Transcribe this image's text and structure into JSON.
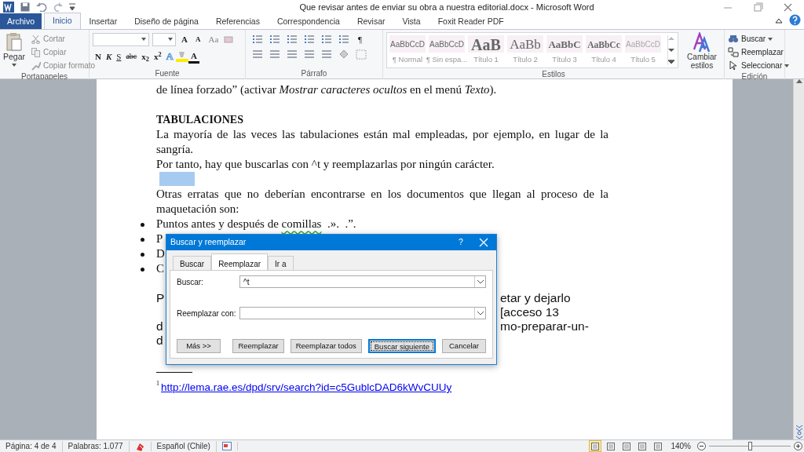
{
  "window": {
    "title": "Que revisar antes de enviar su obra a nuestra editorial.docx  -  Microsoft Word"
  },
  "ribbon_tabs": [
    {
      "label": "Archivo",
      "kind": "file",
      "selected": false
    },
    {
      "label": "Inicio",
      "kind": "tab",
      "selected": true
    },
    {
      "label": "Insertar",
      "kind": "tab",
      "selected": false
    },
    {
      "label": "Diseño de página",
      "kind": "tab",
      "selected": false
    },
    {
      "label": "Referencias",
      "kind": "tab",
      "selected": false
    },
    {
      "label": "Correspondencia",
      "kind": "tab",
      "selected": false
    },
    {
      "label": "Revisar",
      "kind": "tab",
      "selected": false
    },
    {
      "label": "Vista",
      "kind": "tab",
      "selected": false
    },
    {
      "label": "Foxit Reader PDF",
      "kind": "tab",
      "selected": false
    }
  ],
  "clipboard": {
    "paste": "Pegar",
    "commands": [
      "Cortar",
      "Copiar",
      "Copiar formato"
    ],
    "group_label": "Portapapeles"
  },
  "font": {
    "grow": "A",
    "shrink": "A",
    "change_case": "Aa",
    "format_buttons": [
      {
        "label": "N",
        "kind": "bold"
      },
      {
        "label": "K",
        "kind": "italic"
      },
      {
        "label": "S",
        "kind": "underline"
      },
      {
        "label": "abc",
        "kind": "strike"
      },
      {
        "label": "x$_{2}$",
        "kind": "script"
      },
      {
        "label": "x$^{2}$",
        "kind": "script"
      }
    ],
    "text_effect": "A",
    "font_color": "A",
    "group_label": "Fuente"
  },
  "paragraph": {
    "pilcrow": "¶",
    "group_label": "Párrafo"
  },
  "styles": {
    "gallery": [
      {
        "preview": "AaBbCcD",
        "name": "¶ Normal",
        "kind": "body"
      },
      {
        "preview": "AaBbCcD",
        "name": "¶ Sin espa...",
        "kind": "body"
      },
      {
        "preview": "AaB",
        "name": "Título 1",
        "kind": "h1"
      },
      {
        "preview": "AaBb",
        "name": "Título 2",
        "kind": "h2"
      },
      {
        "preview": "AaBbC",
        "name": "Título 3",
        "kind": "h3"
      },
      {
        "preview": "AaBbCc",
        "name": "Título 4",
        "kind": "h4"
      },
      {
        "preview": "AaBbCcD",
        "name": "Título 5",
        "kind": "h5"
      }
    ],
    "change_styles": "Cambiar estilos",
    "group_label": "Estilos"
  },
  "editing": {
    "commands": [
      {
        "label": "Buscar",
        "kind": "find",
        "dropdown": true
      },
      {
        "label": "Reemplazar",
        "kind": "replace",
        "dropdown": false
      },
      {
        "label": "Seleccionar",
        "kind": "select",
        "dropdown": true
      }
    ],
    "group_label": "Edición"
  },
  "document": [
    {
      "kind": "paragraph",
      "text": "de línea forzado” (activar *Mostrar caracteres ocultos* en el menú *Texto*)."
    },
    {
      "kind": "blank"
    },
    {
      "kind": "heading",
      "text": "TABULACIONES"
    },
    {
      "kind": "paragraph",
      "text": "La mayoría de las veces las tabulaciones están mal empleadas, por ejemplo, en lugar de la sangría."
    },
    {
      "kind": "paragraph",
      "text": "Por tanto, hay que buscarlas con ^t y reemplazarlas por ningún carácter."
    },
    {
      "kind": "selection"
    },
    {
      "kind": "paragraph",
      "text": "Otras erratas que no deberían encontrarse en los documentos que llegan al proceso de la maquetación son:"
    },
    {
      "kind": "bullet",
      "parts": [
        {
          "text": "Puntos antes y después de "
        },
        {
          "text": "comillas",
          "flagged": true
        },
        {
          "text": "  .».  .”."
        }
      ]
    },
    {
      "kind": "bullet",
      "parts": [
        {
          "text": "P"
        }
      ]
    },
    {
      "kind": "bullet",
      "parts": [
        {
          "text": "D"
        }
      ]
    },
    {
      "kind": "bullet",
      "parts": [
        {
          "text": "C"
        }
      ]
    },
    {
      "kind": "blank"
    },
    {
      "kind": "split",
      "left": "P",
      "right": "etar y dejarlo [acceso 13"
    },
    {
      "kind": "split",
      "left": "d",
      "right": "mo-preparar-un-"
    },
    {
      "kind": "split",
      "left": "d"
    },
    {
      "kind": "blank"
    },
    {
      "kind": "footnote_rule"
    },
    {
      "kind": "footnote",
      "mark": "1",
      "link": "http://lema.rae.es/dpd/srv/search?id=c5GublcDAD6kWvCUUy"
    }
  ],
  "dialog": {
    "title": "Buscar y reemplazar",
    "help": "?",
    "tabs": [
      {
        "label": "Buscar",
        "selected": false
      },
      {
        "label": "Reemplazar",
        "selected": true
      },
      {
        "label": "Ir a",
        "selected": false
      }
    ],
    "fields": [
      {
        "label": "Buscar:",
        "value": "^t"
      },
      {
        "label": "Reemplazar con:"
      }
    ],
    "buttons": [
      {
        "label": "Más >>",
        "default": false
      },
      {
        "label": "Reemplazar",
        "default": false
      },
      {
        "label": "Reemplazar todos",
        "default": false
      },
      {
        "label": "Buscar siguiente",
        "default": true
      },
      {
        "label": "Cancelar",
        "default": false
      }
    ]
  },
  "status_bar": {
    "items": [
      "Página: 4 de 4",
      "Palabras: 1.077",
      "Español (Chile)"
    ],
    "views": [
      {
        "selected": true
      },
      {
        "selected": false
      },
      {
        "selected": false
      },
      {
        "selected": false
      },
      {
        "selected": false
      }
    ],
    "zoom": {
      "reading": "140%",
      "level": 0.5
    }
  }
}
